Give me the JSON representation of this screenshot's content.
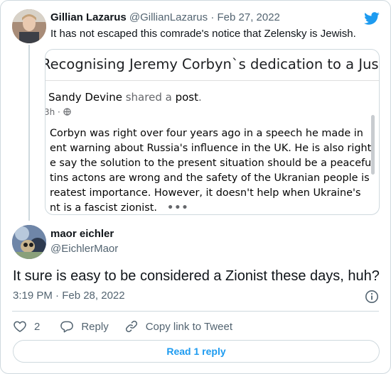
{
  "quoted_tweet": {
    "author_name": "Gillian Lazarus",
    "author_handle": "@GillianLazarus",
    "separator": "·",
    "date": "Feb 27, 2022",
    "text": "It has not escaped this comrade's notice that Zelensky is Jewish.",
    "media": {
      "banner_title": "Recognising Jeremy Corbyn`s dedication to a Just Society",
      "poster_name": "Sandy Devine",
      "poster_action": "shared a",
      "poster_object": "post",
      "poster_suffix": ".",
      "meta": "3h · ",
      "body_lines": [
        "Corbyn was right over four years ago in a speech he made in",
        "ent warning about Russia's influence in the UK.  He is also right",
        "e say the solution to the present situation should be a peaceful",
        "tins actons are wrong and the safety of the Ukranian people is",
        "reatest importance. However, it doesn't help when Ukraine's",
        "nt is a fascist zionist."
      ],
      "more": "•••"
    }
  },
  "reply_tweet": {
    "author_name": "maor eichler",
    "author_handle": "@EichlerMaor",
    "text": "It sure is easy to be considered a Zionist these days, huh?",
    "timestamp": "3:19 PM · Feb 28, 2022",
    "likes_count": "2",
    "reply_label": "Reply",
    "copy_link_label": "Copy link to Tweet",
    "read_replies_label": "Read 1 reply"
  },
  "colors": {
    "brand": "#1d9bf0",
    "secondary_text": "#536471",
    "border": "#cfd9de"
  },
  "icons": [
    "twitter-logo-icon",
    "globe-icon",
    "info-icon",
    "heart-icon",
    "reply-bubble-icon",
    "link-icon"
  ]
}
